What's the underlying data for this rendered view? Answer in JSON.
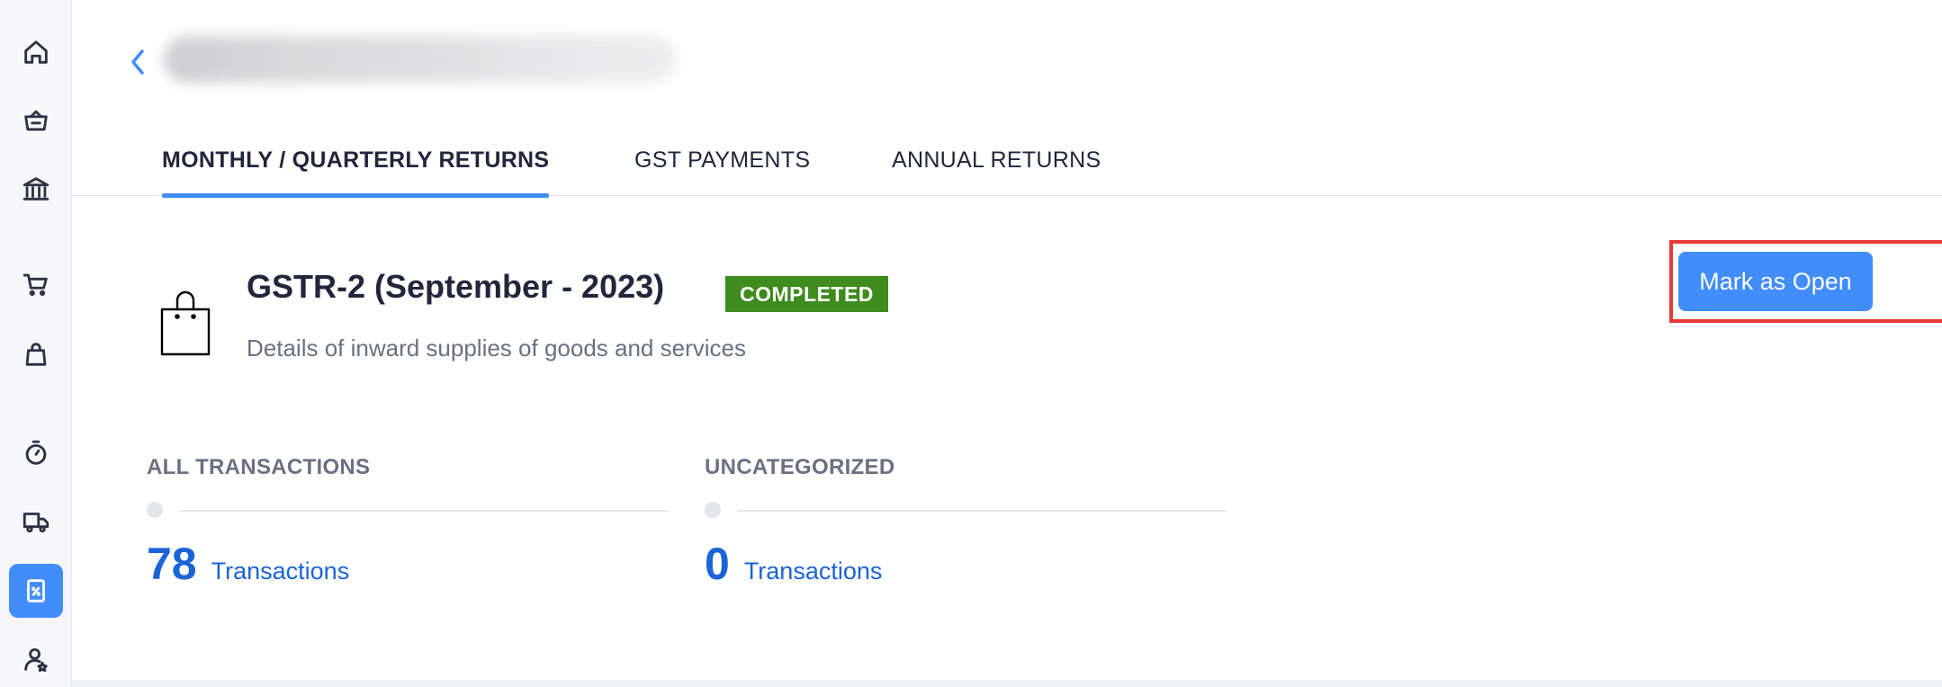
{
  "sidebar": {
    "items": [
      {
        "icon": "home-icon"
      },
      {
        "icon": "basket-icon"
      },
      {
        "icon": "bank-icon"
      },
      {
        "icon": "cart-icon"
      },
      {
        "icon": "shopping-bag-icon"
      },
      {
        "icon": "timer-icon"
      },
      {
        "icon": "truck-icon"
      },
      {
        "icon": "gst-filing-icon",
        "active": true
      },
      {
        "icon": "user-settings-icon"
      }
    ]
  },
  "tabs": [
    {
      "label": "MONTHLY / QUARTERLY RETURNS",
      "active": true
    },
    {
      "label": "GST PAYMENTS",
      "active": false
    },
    {
      "label": "ANNUAL RETURNS",
      "active": false
    }
  ],
  "return": {
    "title": "GSTR-2 (September - 2023)",
    "status": "COMPLETED",
    "description": "Details of inward supplies of goods and services",
    "action_label": "Mark as Open"
  },
  "stats": [
    {
      "label": "ALL TRANSACTIONS",
      "value": "78",
      "unit": "Transactions"
    },
    {
      "label": "UNCATEGORIZED",
      "value": "0",
      "unit": "Transactions"
    }
  ],
  "colors": {
    "accent": "#408dfb",
    "status_completed": "#3e8b1e",
    "highlight": "#e53935",
    "link": "#1a64d6"
  }
}
